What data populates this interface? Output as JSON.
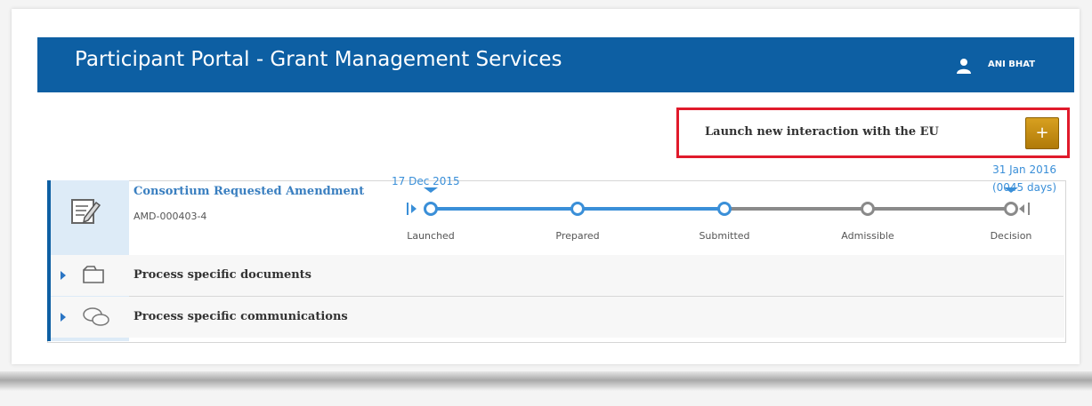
{
  "header": {
    "title": "Participant Portal - Grant Management Services",
    "user_name": "ANI BHAT"
  },
  "launch": {
    "label": "Launch new interaction with the EU",
    "button_label": "+"
  },
  "process": {
    "title": "Consortium Requested Amendment",
    "id": "AMD-000403-4",
    "date_start": "17 Dec 2015",
    "date_end": "31 Jan 2016",
    "date_end_note": "(0045 days)",
    "stages": [
      {
        "label": "Launched",
        "status": "done"
      },
      {
        "label": "Prepared",
        "status": "done"
      },
      {
        "label": "Submitted",
        "status": "done"
      },
      {
        "label": "Admissible",
        "status": "pending"
      },
      {
        "label": "Decision",
        "status": "pending"
      }
    ]
  },
  "rows": [
    {
      "label": "Process specific documents",
      "icon": "folder-icon"
    },
    {
      "label": "Process specific communications",
      "icon": "chat-bubbles-icon"
    }
  ],
  "colors": {
    "brand_blue": "#0d5fa3",
    "accent_blue": "#3a8fd8",
    "highlight_red": "#e01a2b",
    "button_gold": "#c89214",
    "pending_grey": "#8a8a8a"
  }
}
